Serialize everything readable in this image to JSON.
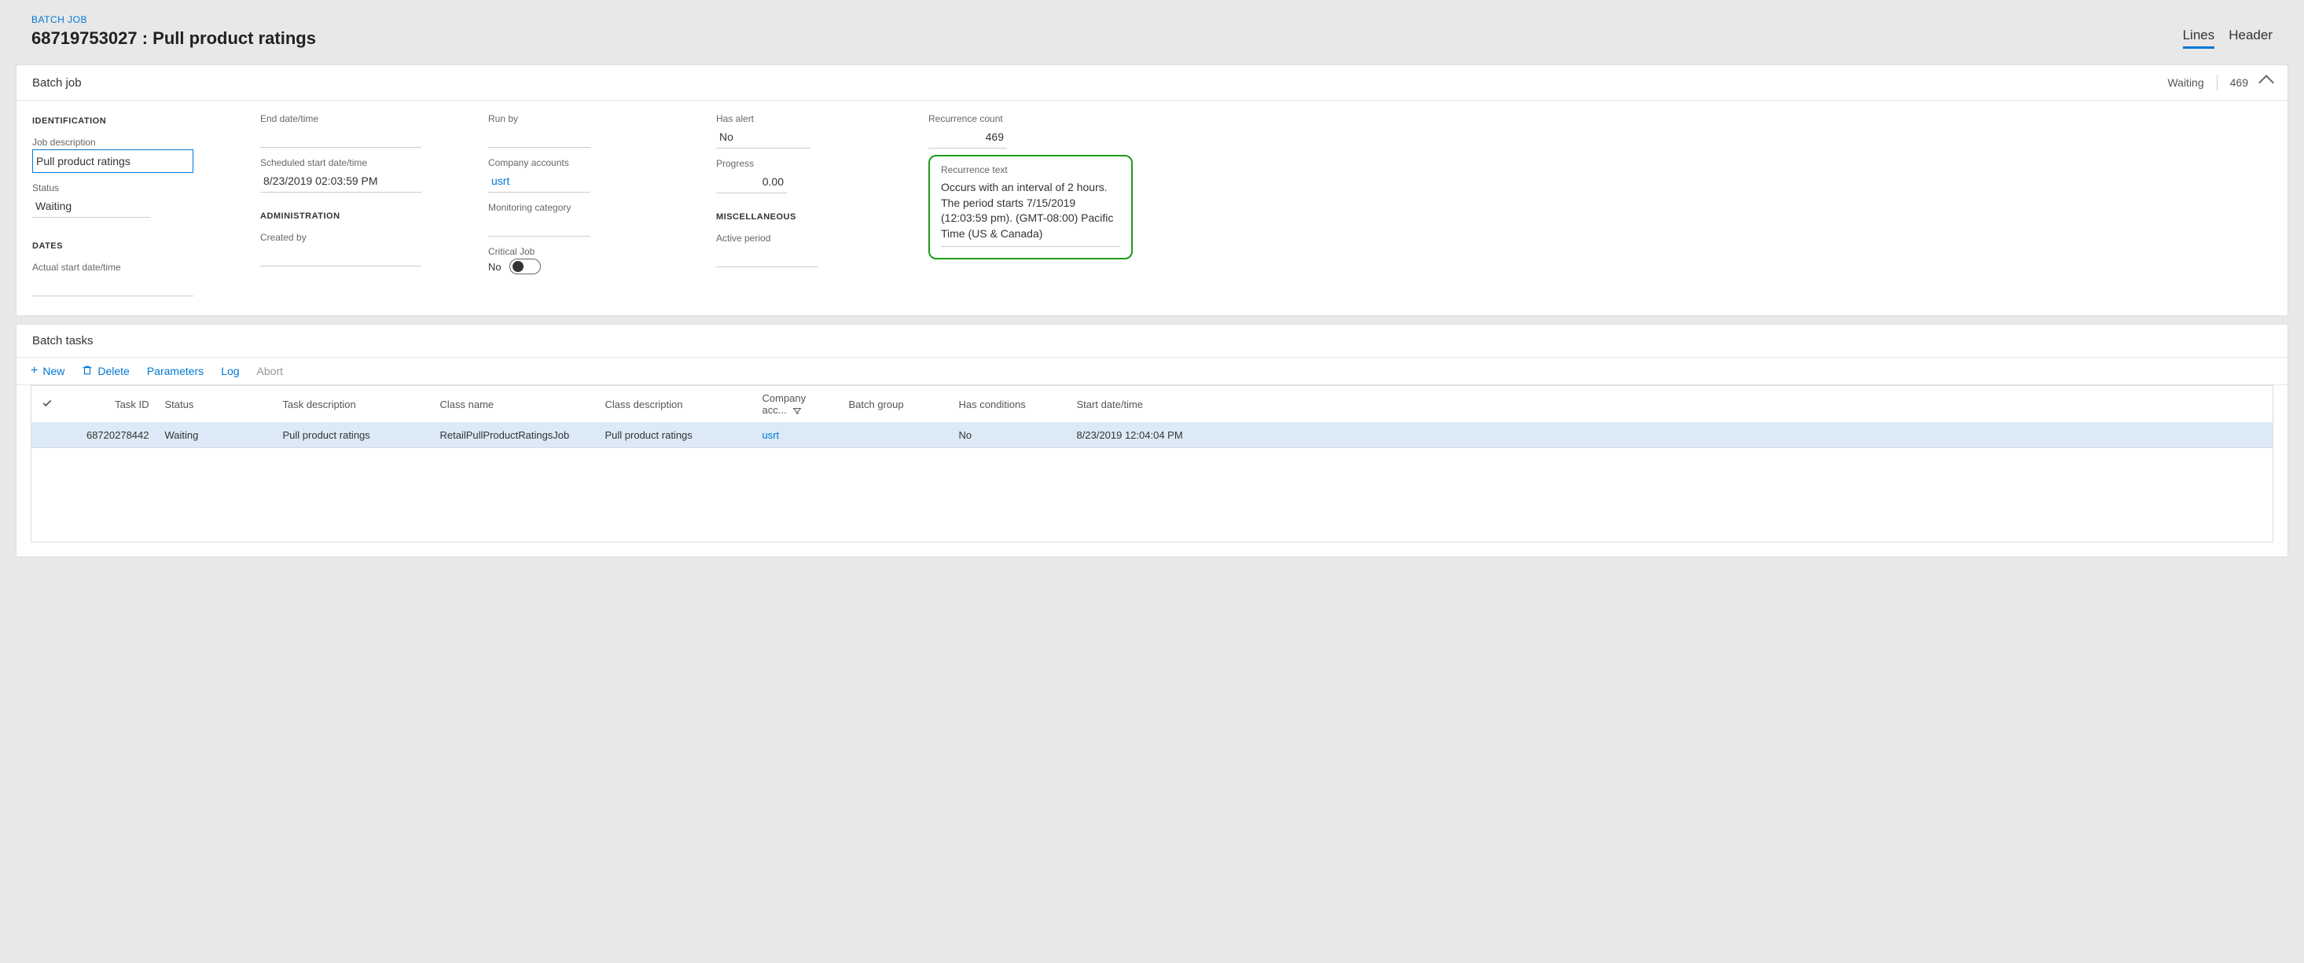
{
  "breadcrumb": "BATCH JOB",
  "page_title": "68719753027 : Pull product ratings",
  "tabs": {
    "lines": "Lines",
    "header": "Header"
  },
  "batch_job_card": {
    "title": "Batch job",
    "status_badge": "Waiting",
    "count_badge": "469",
    "sections": {
      "identification": "IDENTIFICATION",
      "dates": "DATES",
      "administration": "ADMINISTRATION",
      "miscellaneous": "MISCELLANEOUS"
    },
    "labels": {
      "job_description": "Job description",
      "status": "Status",
      "actual_start": "Actual start date/time",
      "end_date": "End date/time",
      "scheduled_start": "Scheduled start date/time",
      "created_by": "Created by",
      "run_by": "Run by",
      "company_accounts": "Company accounts",
      "monitoring_category": "Monitoring category",
      "critical_job": "Critical Job",
      "has_alert": "Has alert",
      "progress": "Progress",
      "active_period": "Active period",
      "recurrence_count": "Recurrence count",
      "recurrence_text": "Recurrence text"
    },
    "values": {
      "job_description": "Pull product ratings",
      "status": "Waiting",
      "actual_start": "",
      "end_date": "",
      "scheduled_start": "8/23/2019 02:03:59 PM",
      "created_by": "",
      "run_by": "",
      "company_accounts": "usrt",
      "monitoring_category": "",
      "critical_job": "No",
      "has_alert": "No",
      "progress": "0.00",
      "active_period": "",
      "recurrence_count": "469",
      "recurrence_text": "Occurs with an interval of 2 hours. The period starts 7/15/2019 (12:03:59 pm). (GMT-08:00) Pacific Time (US & Canada)"
    }
  },
  "batch_tasks_card": {
    "title": "Batch tasks",
    "toolbar": {
      "new": "New",
      "delete": "Delete",
      "parameters": "Parameters",
      "log": "Log",
      "abort": "Abort"
    },
    "columns": {
      "task_id": "Task ID",
      "status": "Status",
      "task_description": "Task description",
      "class_name": "Class name",
      "class_description": "Class description",
      "company_acc": "Company acc...",
      "batch_group": "Batch group",
      "has_conditions": "Has conditions",
      "start_date": "Start date/time"
    },
    "rows": [
      {
        "task_id": "68720278442",
        "status": "Waiting",
        "task_description": "Pull product ratings",
        "class_name": "RetailPullProductRatingsJob",
        "class_description": "Pull product ratings",
        "company_acc": "usrt",
        "batch_group": "",
        "has_conditions": "No",
        "start_date": "8/23/2019 12:04:04 PM"
      }
    ]
  }
}
